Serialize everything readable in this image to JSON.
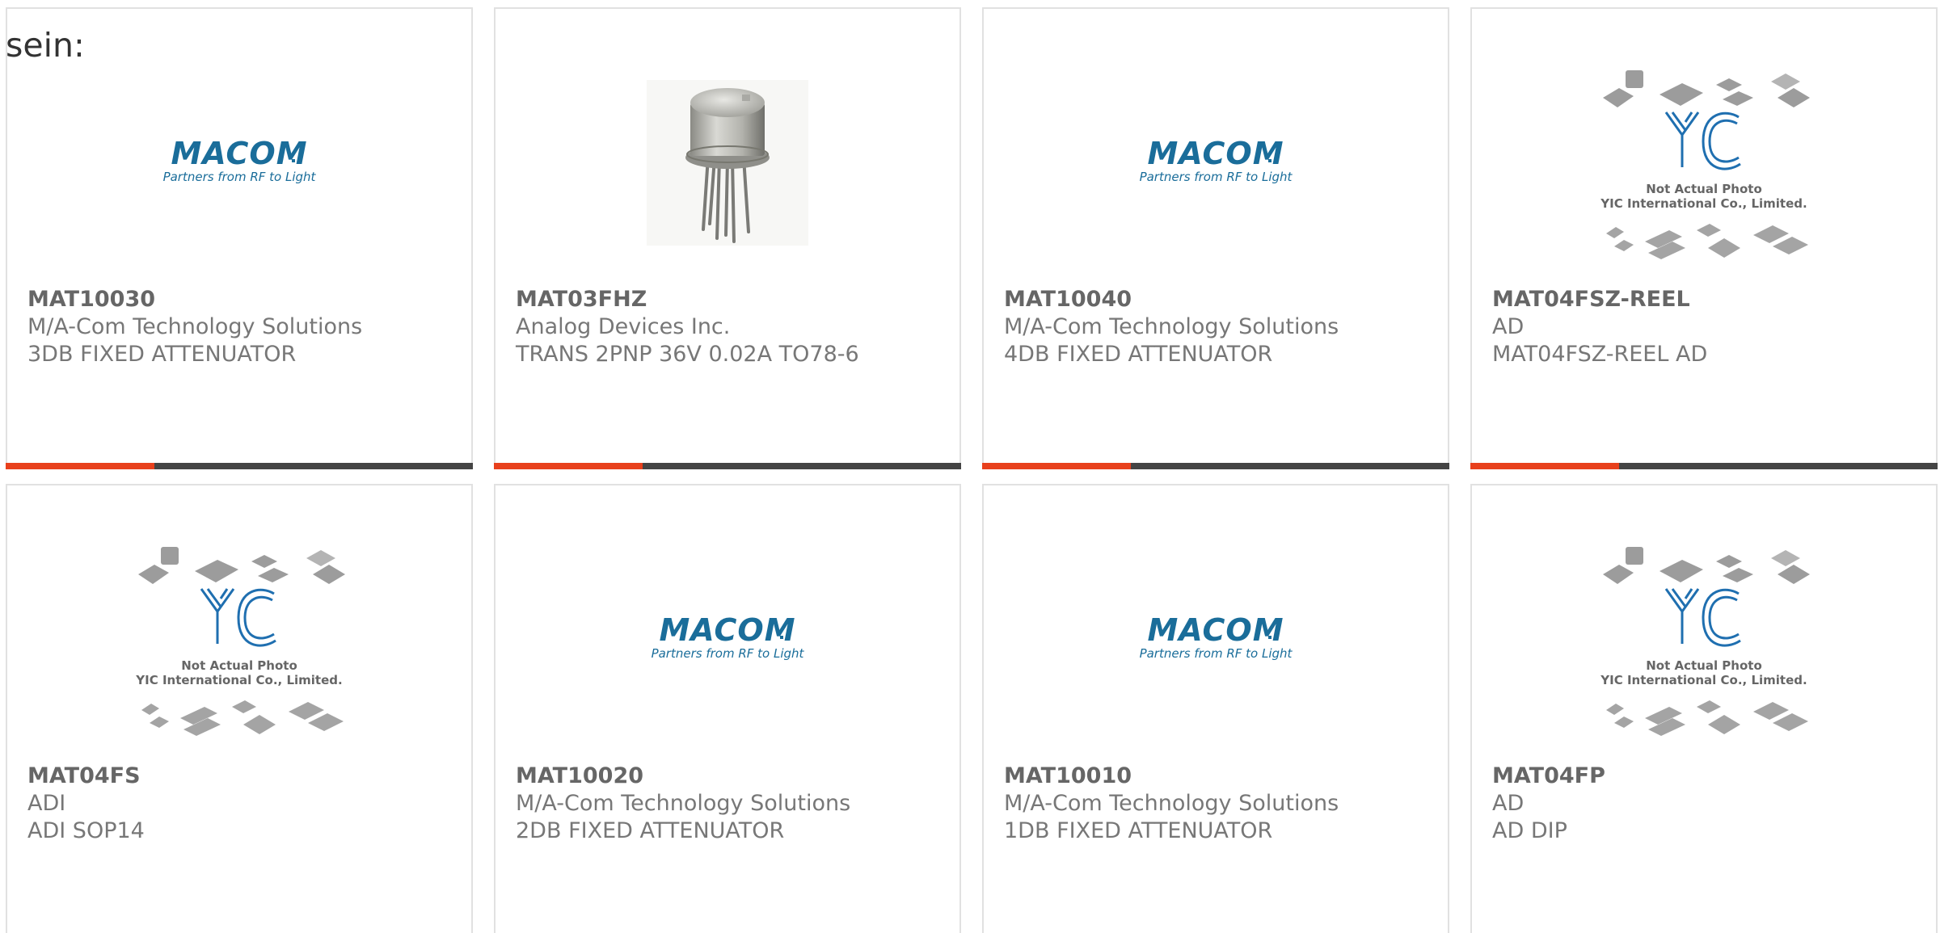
{
  "intro_text": "sein:",
  "colors": {
    "accent": "#e8401c",
    "bar_dark": "#444444",
    "macom_blue": "#1a6d9a",
    "yic_blue": "#1f6fb0"
  },
  "logos": {
    "macom": {
      "word": "MACOM",
      "tagline": "Partners from RF to Light"
    },
    "yic": {
      "line1": "Not Actual Photo",
      "line2": "YIC International Co., Limited."
    }
  },
  "products": [
    {
      "part_number": "MAT10030",
      "manufacturer": "M/A-Com Technology Solutions",
      "description": "3DB FIXED ATTENUATOR",
      "image": "macom-logo"
    },
    {
      "part_number": "MAT03FHZ",
      "manufacturer": "Analog Devices Inc.",
      "description": "TRANS 2PNP 36V 0.02A TO78-6",
      "image": "to78-transistor-photo"
    },
    {
      "part_number": "MAT10040",
      "manufacturer": "M/A-Com Technology Solutions",
      "description": "4DB FIXED ATTENUATOR",
      "image": "macom-logo"
    },
    {
      "part_number": "MAT04FSZ-REEL",
      "manufacturer": "AD",
      "description": "MAT04FSZ-REEL AD",
      "image": "yic-placeholder"
    },
    {
      "part_number": "MAT04FS",
      "manufacturer": "ADI",
      "description": "ADI SOP14",
      "image": "yic-placeholder"
    },
    {
      "part_number": "MAT10020",
      "manufacturer": "M/A-Com Technology Solutions",
      "description": "2DB FIXED ATTENUATOR",
      "image": "macom-logo"
    },
    {
      "part_number": "MAT10010",
      "manufacturer": "M/A-Com Technology Solutions",
      "description": "1DB FIXED ATTENUATOR",
      "image": "macom-logo"
    },
    {
      "part_number": "MAT04FP",
      "manufacturer": "AD",
      "description": "AD DIP",
      "image": "yic-placeholder"
    }
  ]
}
